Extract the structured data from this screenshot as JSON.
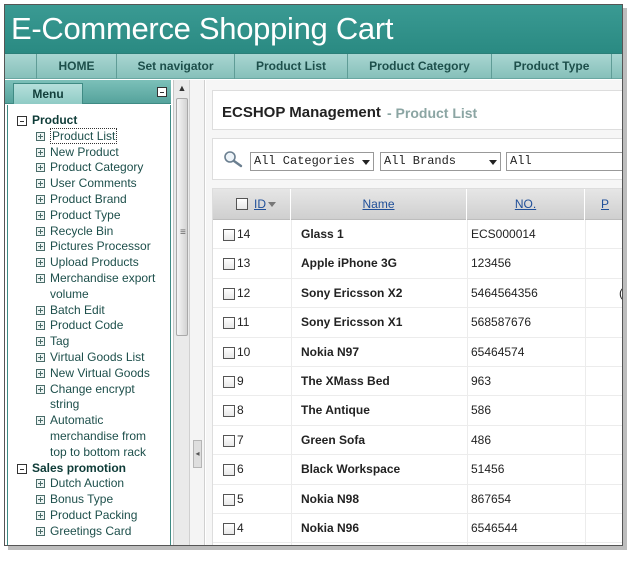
{
  "app": {
    "title": "E-Commerce Shopping Cart"
  },
  "nav": {
    "items": [
      {
        "label": "HOME"
      },
      {
        "label": "Set navigator"
      },
      {
        "label": "Product List"
      },
      {
        "label": "Product Category"
      },
      {
        "label": "Product Type"
      }
    ]
  },
  "menu": {
    "tab_label": "Menu",
    "groups": [
      {
        "label": "Product",
        "items": [
          "Product List",
          "New Product",
          "Product Category",
          "User Comments",
          "Product Brand",
          "Product Type",
          "Recycle Bin",
          "Pictures Processor",
          "Upload Products",
          "Merchandise export volume",
          "Batch Edit",
          "Product Code",
          "Tag",
          "Virtual Goods List",
          "New Virtual Goods",
          "Change encrypt string",
          "Automatic merchandise from top to bottom rack"
        ]
      },
      {
        "label": "Sales promotion",
        "items": [
          "Dutch Auction",
          "Bonus Type",
          "Product Packing",
          "Greetings Card"
        ]
      }
    ]
  },
  "page": {
    "title": "ECSHOP Management",
    "subtitle": "- Product List"
  },
  "filters": {
    "category": "All Categories",
    "brand": "All Brands",
    "other": "All"
  },
  "table": {
    "headers": {
      "id": "ID",
      "name": "Name",
      "no": "NO.",
      "next": "P"
    },
    "rows": [
      {
        "id": "14",
        "name": "Glass 1",
        "no": "ECS000014",
        "extra": ""
      },
      {
        "id": "13",
        "name": "Apple iPhone 3G",
        "no": "123456",
        "extra": ""
      },
      {
        "id": "12",
        "name": "Sony Ericsson X2",
        "no": "5464564356",
        "extra": "("
      },
      {
        "id": "11",
        "name": "Sony Ericsson X1",
        "no": "568587676",
        "extra": ""
      },
      {
        "id": "10",
        "name": "Nokia N97",
        "no": "65464574",
        "extra": ""
      },
      {
        "id": "9",
        "name": "The XMass Bed",
        "no": "963",
        "extra": ""
      },
      {
        "id": "8",
        "name": "The Antique",
        "no": "586",
        "extra": ""
      },
      {
        "id": "7",
        "name": "Green Sofa",
        "no": "486",
        "extra": ""
      },
      {
        "id": "6",
        "name": "Black Workspace",
        "no": "51456",
        "extra": ""
      },
      {
        "id": "5",
        "name": "Nokia N98",
        "no": "867654",
        "extra": ""
      },
      {
        "id": "4",
        "name": "Nokia N96",
        "no": "6546544",
        "extra": ""
      }
    ]
  },
  "icons": {
    "search": "search-icon",
    "collapse": "collapse-icon",
    "sort": "sort-down-icon"
  },
  "colors": {
    "header": "#2a8a82",
    "nav": "#9fd0cb",
    "link": "#1f4f99",
    "subtitle": "#8ba5a3"
  }
}
